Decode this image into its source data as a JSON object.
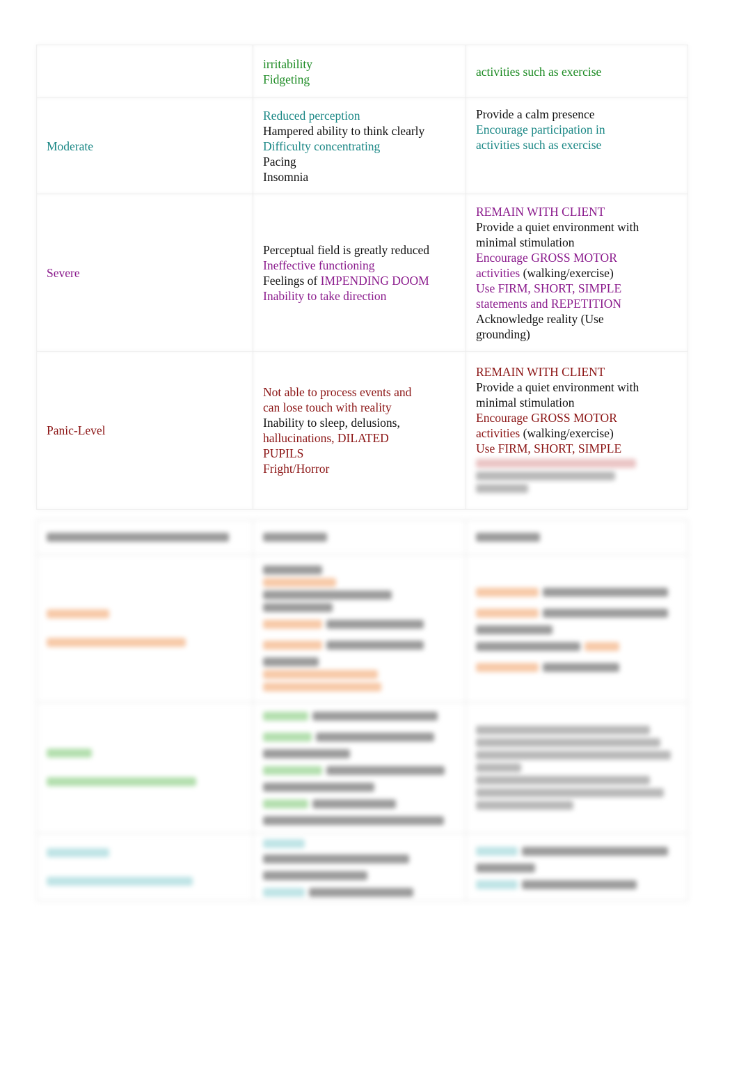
{
  "document": {
    "anxiety_table": {
      "rows": [
        {
          "level": {
            "text": "",
            "color": "green"
          },
          "symptoms": [
            {
              "text": "irritability",
              "color": "green"
            },
            {
              "text": "Fidgeting",
              "color": "green"
            }
          ],
          "interventions": [
            {
              "text": "activities such as exercise",
              "color": "green"
            }
          ]
        },
        {
          "level": {
            "text": "Moderate",
            "color": "teal"
          },
          "symptoms": [
            {
              "text": "Reduced perception",
              "color": "teal"
            },
            {
              "text": "Hampered ability to think clearly",
              "color": "black"
            },
            {
              "text": "Difficulty concentrating",
              "color": "teal"
            },
            {
              "text": "Pacing",
              "color": "black"
            },
            {
              "text": "Insomnia",
              "color": "black"
            }
          ],
          "interventions": [
            {
              "text": "Provide a calm presence",
              "color": "black"
            },
            {
              "text": "Encourage participation in",
              "color": "teal"
            },
            {
              "text": "activities such as exercise",
              "color": "teal"
            }
          ]
        },
        {
          "level": {
            "text": "Severe",
            "color": "purple"
          },
          "symptoms": [
            {
              "text": "Perceptual field is greatly reduced",
              "color": "black"
            },
            {
              "text": "Ineffective functioning",
              "color": "purple"
            },
            {
              "segments": [
                {
                  "text": "Feelings of ",
                  "color": "black"
                },
                {
                  "text": "IMPENDING DOOM",
                  "color": "purple"
                }
              ]
            },
            {
              "text": "Inability to take direction",
              "color": "purple"
            }
          ],
          "interventions": [
            {
              "text": "REMAIN WITH CLIENT",
              "color": "purple"
            },
            {
              "text": "Provide a quiet environment with",
              "color": "black"
            },
            {
              "text": "minimal stimulation",
              "color": "black"
            },
            {
              "text": "Encourage GROSS MOTOR",
              "color": "purple"
            },
            {
              "segments": [
                {
                  "text": "activities ",
                  "color": "purple"
                },
                {
                  "text": " (walking/exercise)",
                  "color": "black"
                }
              ]
            },
            {
              "text": "Use FIRM, SHORT, SIMPLE",
              "color": "purple"
            },
            {
              "text": "statements and REPETITION",
              "color": "purple"
            },
            {
              "text": "Acknowledge reality (Use",
              "color": "black"
            },
            {
              "text": "grounding)",
              "color": "black"
            }
          ]
        },
        {
          "level": {
            "text": "Panic-Level",
            "color": "red"
          },
          "symptoms": [
            {
              "text": "Not able to process events and",
              "color": "red"
            },
            {
              "text": "can lose touch with reality",
              "color": "red"
            },
            {
              "text": "Inability to sleep, delusions,",
              "color": "black"
            },
            {
              "text": "hallucinations, DILATED",
              "color": "red"
            },
            {
              "text": "PUPILS",
              "color": "red"
            },
            {
              "text": "Fright/Horror",
              "color": "red"
            }
          ],
          "interventions": [
            {
              "text": "REMAIN WITH CLIENT",
              "color": "red"
            },
            {
              "text": "Provide a quiet environment with",
              "color": "black"
            },
            {
              "text": "minimal stimulation",
              "color": "black"
            },
            {
              "text": "Encourage GROSS MOTOR",
              "color": "red"
            },
            {
              "segments": [
                {
                  "text": "activities ",
                  "color": "red"
                },
                {
                  "text": " (walking/exercise)",
                  "color": "black"
                }
              ]
            },
            {
              "text": "Use FIRM, SHORT, SIMPLE",
              "color": "red"
            }
          ],
          "interventions_blurred_lines": 3
        }
      ]
    },
    "colors": {
      "green": "#1b8a22",
      "teal": "#1a8785",
      "purple": "#8a1a8c",
      "red": "#8b1414",
      "black": "#111111"
    },
    "blurred_section_note": "Lower table content is obscured (blurred) in the source image"
  }
}
